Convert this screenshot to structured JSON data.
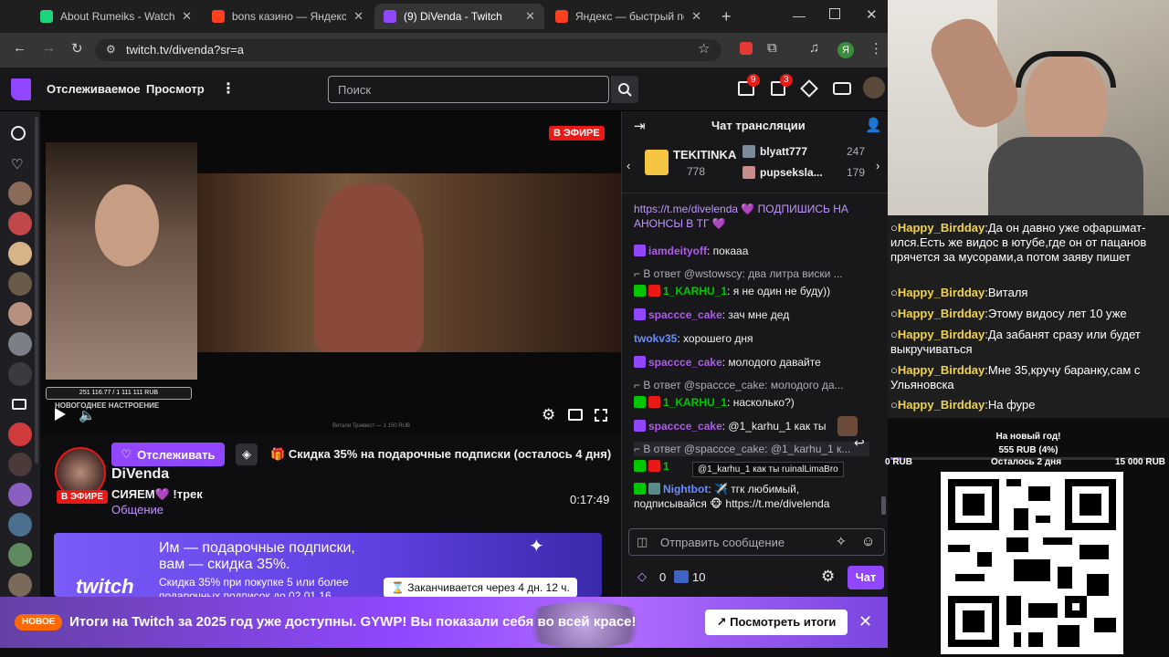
{
  "browser": {
    "tabs": [
      {
        "title": "About Rumeiks - Watch Li",
        "color": "#1dd57c",
        "active": false
      },
      {
        "title": "bons казино — Яндекс: на",
        "color": "#fc3f1d",
        "active": false
      },
      {
        "title": "(9) DiVenda - Twitch",
        "color": "#9147ff",
        "active": true
      },
      {
        "title": "Яндекс — быстрый поиск",
        "color": "#fc3f1d",
        "active": false
      }
    ],
    "url": "twitch.tv/divenda?sr=a"
  },
  "nav": {
    "following": "Отслеживаемое",
    "browse": "Просмотр",
    "search_placeholder": "Поиск",
    "inbox_count": "9",
    "whispers_count": "3"
  },
  "stream": {
    "live_label": "В ЭФИРЕ",
    "overlay_goal": "251 116.77 / 1 111 111 RUB",
    "overlay_caption": "НОВОГОДНЕЕ НАСТРОЕНИЕ",
    "overlay_bottom": "Виталя Трэквест — 1 150 RUB"
  },
  "channel": {
    "follow": "Отслеживать",
    "name": "DiVenda",
    "title": "СИЯЕМ💜 !трек",
    "category": "Общение",
    "live": "В ЭФИРЕ",
    "uptime": "0:17:49",
    "discount": "Скидка 35% на подарочные подписки (осталось 4 дня)"
  },
  "promo": {
    "headline1": "Им — подарочные подписки,",
    "headline2": "вам — скидка 35%.",
    "sub1": "Скидка 35% при покупке 5 или более",
    "sub2": "подарочных подписок до 02.01.16",
    "brand": "twitch",
    "timer": "Заканчивается через 4 дн. 12 ч."
  },
  "chat": {
    "header": "Чат трансляции",
    "gifters": [
      {
        "name": "TEKITINKA",
        "count": "778"
      },
      {
        "name": "blyatt777",
        "count": "247"
      },
      {
        "name": "pupseksla...",
        "count": "179"
      }
    ],
    "messages": [
      {
        "type": "msg",
        "user": "",
        "color": "#adadb8",
        "text": "https://t.me/divelenda 💜 ПОДПИШИСЬ НА АНОНСЫ В ТГ 💜"
      },
      {
        "type": "msg",
        "user": "iamdeityoff",
        "color": "#9147ff",
        "text": ": покааа"
      },
      {
        "type": "reply",
        "text": "В ответ @wstowscy: два литра виски ..."
      },
      {
        "type": "msg",
        "user": "1_KARHU_1",
        "color": "#00c800",
        "text": ": я не один не буду))"
      },
      {
        "type": "msg",
        "user": "spaccce_cake",
        "color": "#b05af0",
        "text": ": зач мне дед"
      },
      {
        "type": "msg",
        "user": "twokv35",
        "color": "#6a8dff",
        "text": ": хорошего дня"
      },
      {
        "type": "msg",
        "user": "spaccce_cake",
        "color": "#b05af0",
        "text": ": молодого давайте"
      },
      {
        "type": "reply",
        "text": "В ответ @spaccce_cake: молодого да..."
      },
      {
        "type": "msg",
        "user": "1_KARHU_1",
        "color": "#00c800",
        "text": ": насколько?)"
      },
      {
        "type": "msg",
        "user": "spaccce_cake",
        "color": "#b05af0",
        "text": ": @1_karhu_1 как ты"
      },
      {
        "type": "reply",
        "text": "В ответ @spaccce_cake: @1_karhu_1 к..."
      },
      {
        "type": "msg",
        "user": "1",
        "color": "#00c800",
        "text": ""
      },
      {
        "type": "msg",
        "user": "Nightbot",
        "color": "#6a8dff",
        "text": ": ✈️ тгк любимый, подписывайся 🐵 https://t.me/divelenda"
      }
    ],
    "tooltip": "@1_karhu_1 как ты ruinalLimaBro",
    "input_placeholder": "Отправить сообщение",
    "points": "0",
    "bits": "10",
    "send": "Чат"
  },
  "announcement": {
    "pill": "НОВОЕ",
    "text": "Итоги на Twitch за 2025 год уже доступны. GYWP! Вы показали себя во всей красе!",
    "button": "Посмотреть итоги"
  },
  "overlay": {
    "chat": [
      {
        "user": "Happy_Birdday",
        "text": "Да он давно уже офаршмат-ился.Есть же видос в ютубе,где он от пацанов прячется за мусорами,а потом заяву пишет"
      },
      {
        "user": "Happy_Birdday",
        "text": "Виталя"
      },
      {
        "user": "Happy_Birdday",
        "text": "Этому видосу лет 10 уже"
      },
      {
        "user": "Happy_Birdday",
        "text": "Да забанят сразу или будет выкручиваться"
      },
      {
        "user": "Happy_Birdday",
        "text": "Мне 35,кручу баранку,сам с Ульяновска"
      },
      {
        "user": "Happy_Birdday",
        "text": "На фуре"
      }
    ],
    "goal_title": "На новый год!",
    "goal_amount": "555 RUB (4%)",
    "goal_progress": 0.04,
    "goal_min": "0 RUB",
    "goal_left": "Осталось 2 дня",
    "goal_max": "15 000 RUB"
  }
}
